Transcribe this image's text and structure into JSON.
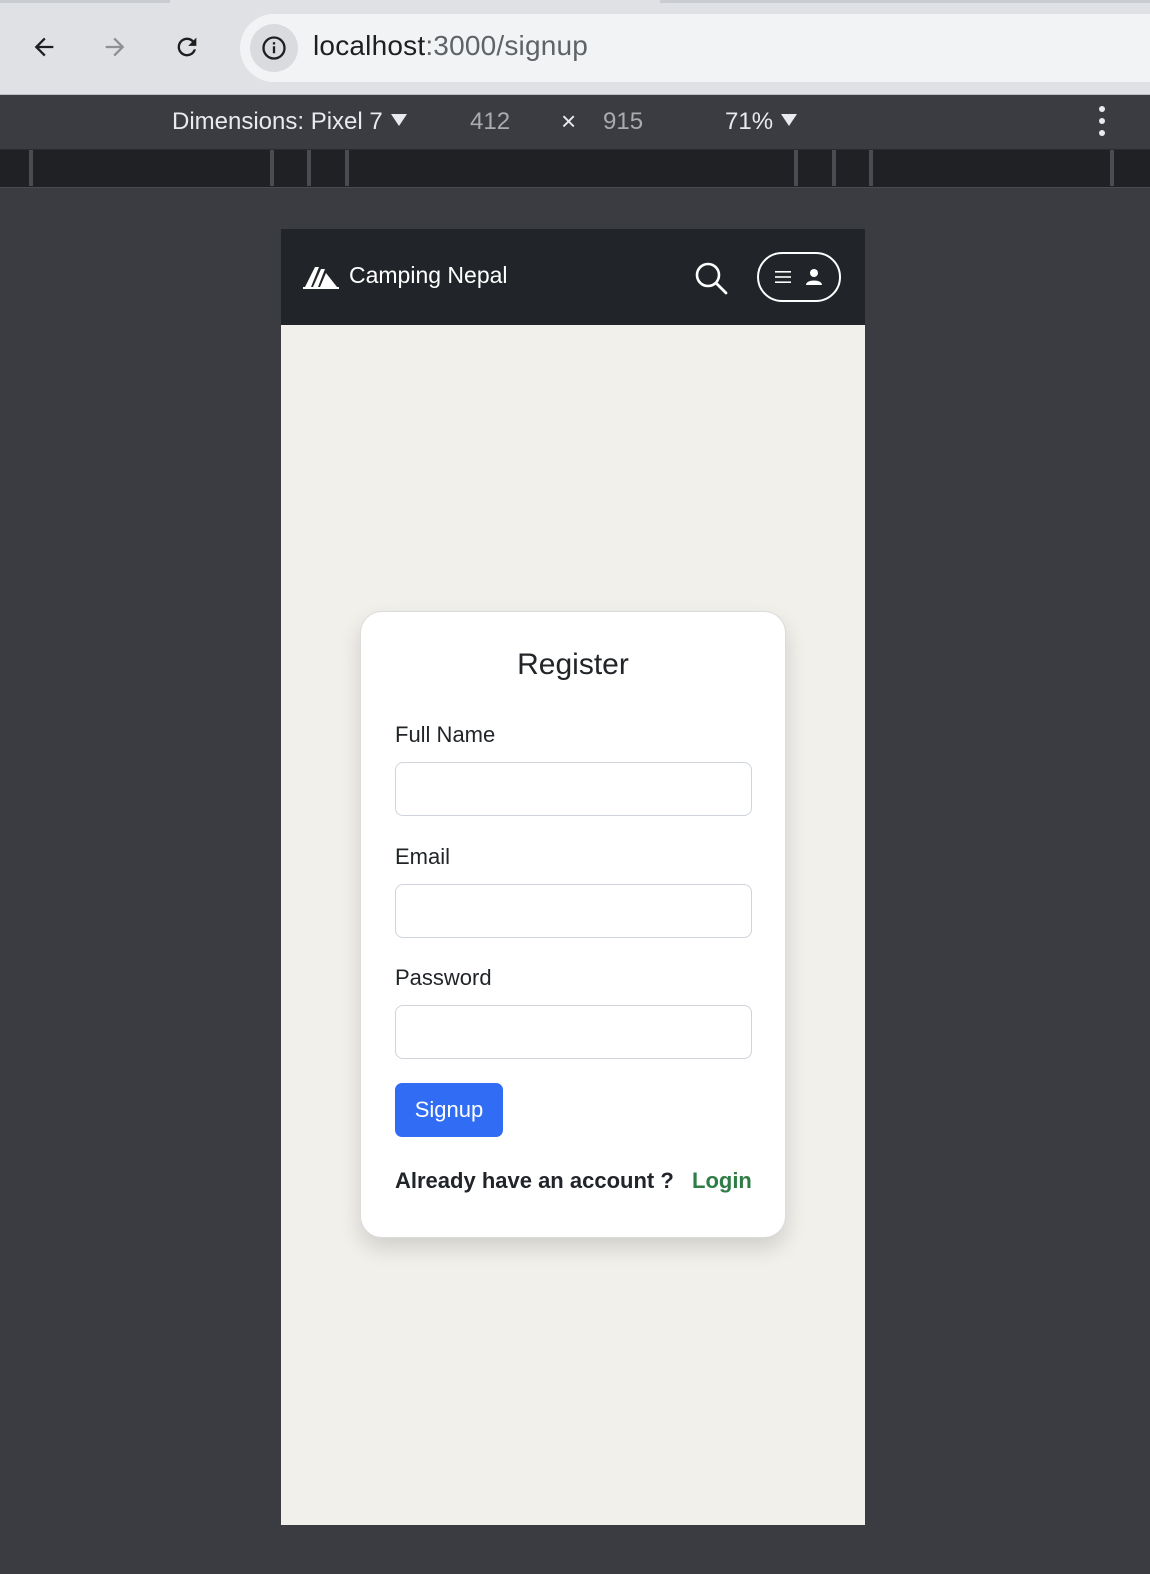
{
  "browser": {
    "url_host": "localhost",
    "url_path": ":3000/signup",
    "back_icon": "arrow-left-icon",
    "forward_icon": "arrow-right-icon",
    "reload_icon": "reload-icon",
    "site_info_icon": "info-icon"
  },
  "devtools": {
    "device_label": "Dimensions: Pixel 7",
    "width": "412",
    "separator": "×",
    "height": "915",
    "zoom": "71%"
  },
  "app": {
    "brand": "Camping Nepal",
    "brand_icon": "tent-icon",
    "search_icon": "search-icon",
    "menu_icon": "hamburger-icon",
    "user_icon": "user-icon",
    "navbar_color": "#212529",
    "background_color": "#f2f0eb"
  },
  "register": {
    "title": "Register",
    "fields": [
      {
        "label": "Full Name",
        "value": "",
        "placeholder": ""
      },
      {
        "label": "Email",
        "value": "",
        "placeholder": ""
      },
      {
        "label": "Password",
        "value": "",
        "placeholder": ""
      }
    ],
    "submit_label": "Signup",
    "submit_color": "#316cf4",
    "login_prompt": "Already have an account ?",
    "login_label": "Login",
    "login_color": "#2f7d46"
  }
}
